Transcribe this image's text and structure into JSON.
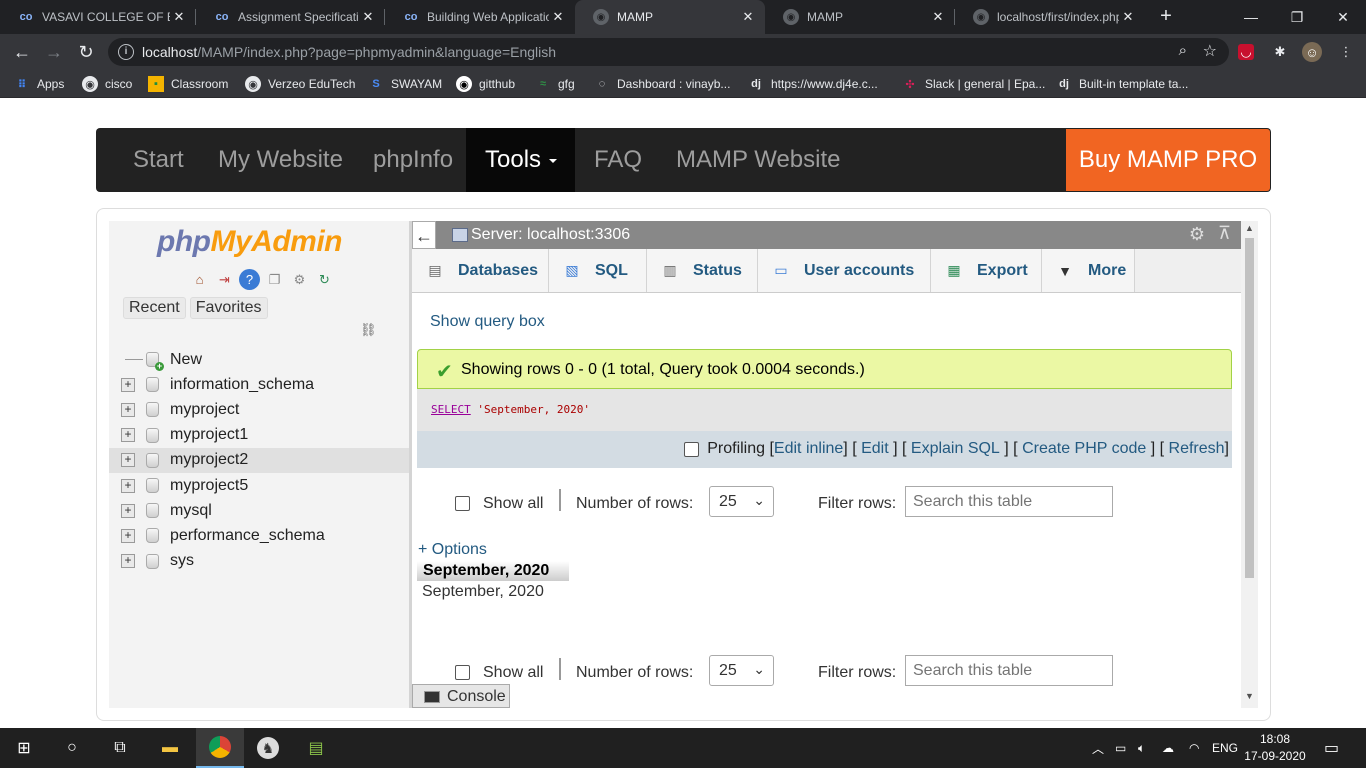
{
  "browser": {
    "tabs": [
      {
        "title": "VASAVI COLLEGE OF EN",
        "icon": "co-icon"
      },
      {
        "title": "Assignment Specificatio",
        "icon": "co-icon"
      },
      {
        "title": "Building Web Applicatio",
        "icon": "co-icon"
      },
      {
        "title": "MAMP",
        "icon": "globe-icon"
      },
      {
        "title": "MAMP",
        "icon": "globe-icon"
      },
      {
        "title": "localhost/first/index.php",
        "icon": "globe-icon"
      }
    ],
    "url_host": "localhost",
    "url_path": "/MAMP/index.php?page=phpmyadmin&language=English",
    "bookmarks": [
      "Apps",
      "cisco",
      "Classroom",
      "Verzeo EduTech",
      "SWAYAM",
      "gitthub",
      "gfg",
      "Dashboard : vinayb...",
      "https://www.dj4e.c...",
      "Slack | general | Epa...",
      "Built-in template ta..."
    ]
  },
  "mamp": {
    "nav": [
      "Start",
      "My Website",
      "phpInfo",
      "Tools",
      "FAQ",
      "MAMP Website"
    ],
    "buy": "Buy MAMP PRO",
    "accent": "#f16522"
  },
  "pma": {
    "logo_php": "php",
    "logo_myadmin": "MyAdmin",
    "recent": "Recent",
    "favorites": "Favorites",
    "tree": [
      "New",
      "information_schema",
      "myproject",
      "myproject1",
      "myproject2",
      "myproject5",
      "mysql",
      "performance_schema",
      "sys"
    ],
    "server": "Server: localhost:3306",
    "tabs": [
      "Databases",
      "SQL",
      "Status",
      "User accounts",
      "Export",
      "More"
    ],
    "show_query_box": "Show query box",
    "success_msg": "Showing rows 0 - 0 (1 total, Query took 0.0004 seconds.)",
    "sql_keyword": "SELECT",
    "sql_string": "'September, 2020'",
    "profiling": "Profiling",
    "links": [
      "Edit inline",
      "Edit",
      "Explain SQL",
      "Create PHP code",
      "Refresh"
    ],
    "show_all": "Show all",
    "number_of_rows": "Number of rows:",
    "rows_value": "25",
    "filter_rows": "Filter rows:",
    "search_placeholder": "Search this table",
    "options": "+ Options",
    "column_header": "September, 2020",
    "cell_value": "September, 2020",
    "console": "Console"
  },
  "taskbar": {
    "lang": "ENG",
    "time": "18:08",
    "date": "17-09-2020"
  }
}
